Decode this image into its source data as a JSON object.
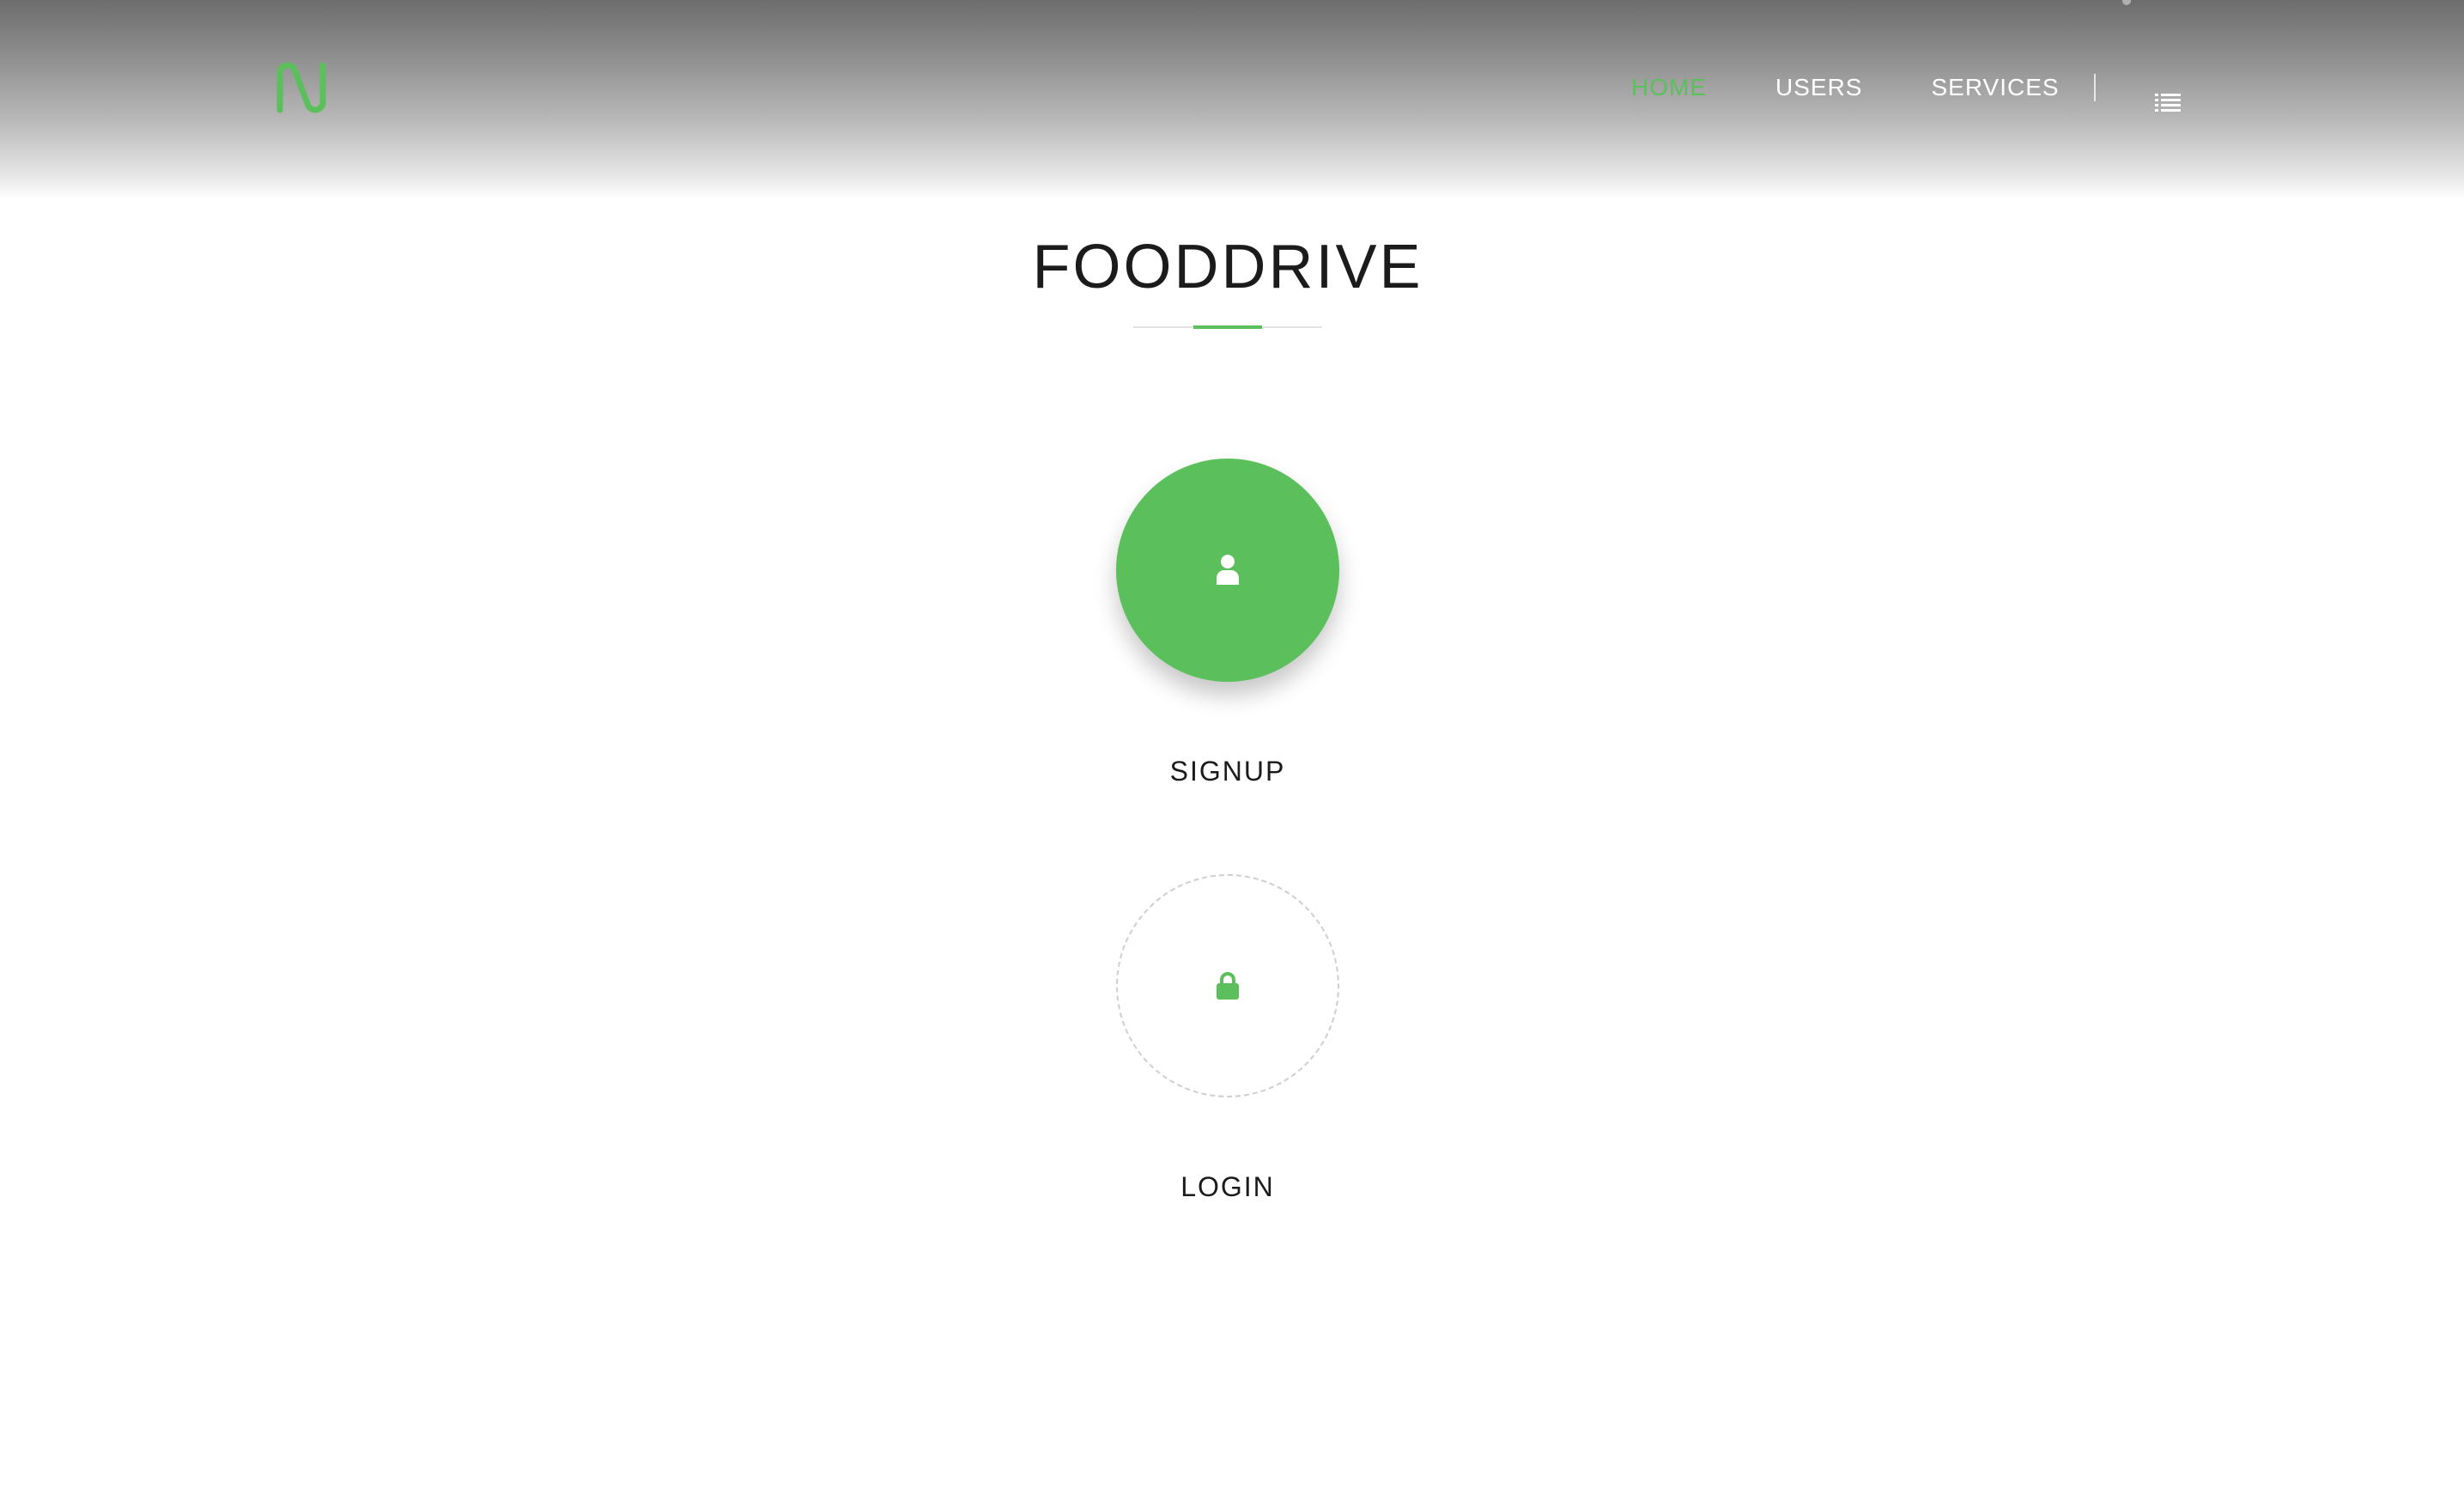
{
  "colors": {
    "accent": "#5bbf5c",
    "nav_text": "#ffffff",
    "title_text": "#1b1b1b"
  },
  "header": {
    "logo_icon": "n-logo-icon",
    "nav": {
      "items": [
        {
          "label": "HOME",
          "active": true
        },
        {
          "label": "USERS",
          "active": false
        },
        {
          "label": "SERVICES",
          "active": false
        }
      ],
      "menu_icon": "list-menu-icon"
    }
  },
  "main": {
    "title": "FOODDRIVE",
    "actions": {
      "signup": {
        "label": "SIGNUP",
        "icon": "user-icon"
      },
      "login": {
        "label": "LOGIN",
        "icon": "lock-icon"
      }
    }
  }
}
